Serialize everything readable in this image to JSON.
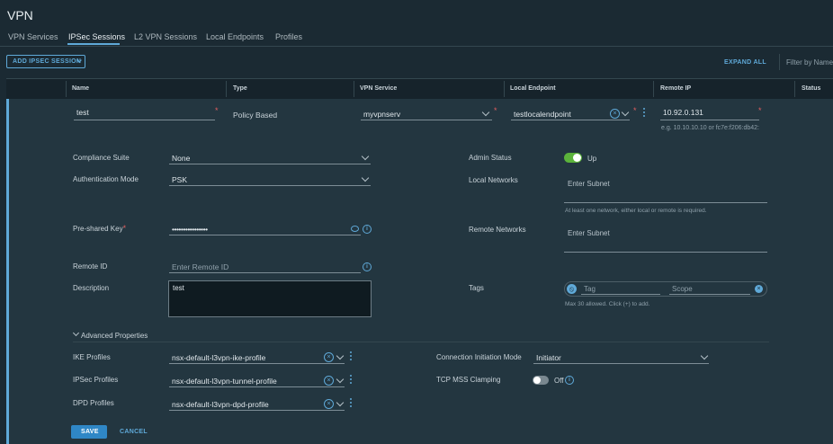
{
  "app": {
    "title": "VPN"
  },
  "tabs": [
    {
      "label": "VPN Services"
    },
    {
      "label": "IPSec Sessions"
    },
    {
      "label": "L2 VPN Sessions"
    },
    {
      "label": "Local Endpoints"
    },
    {
      "label": "Profiles"
    }
  ],
  "toolbar": {
    "add_label": "ADD IPSEC SESSION",
    "expand_label": "EXPAND ALL",
    "filter_placeholder": "Filter by Name,"
  },
  "table": {
    "columns": [
      "Name",
      "Type",
      "VPN Service",
      "Local Endpoint",
      "Remote IP",
      "Status"
    ]
  },
  "row": {
    "name": "test",
    "type": "Policy Based",
    "vpn_service": "myvpnserv",
    "local_endpoint": "testlocalendpoint",
    "remote_ip": "10.92.0.131",
    "remote_ip_hint": "e.g. 10.10.10.10 or fc7e:f206:db42:"
  },
  "form": {
    "compliance_suite": {
      "label": "Compliance Suite",
      "value": "None"
    },
    "auth_mode": {
      "label": "Authentication Mode",
      "value": "PSK"
    },
    "psk": {
      "label": "Pre-shared Key",
      "value": "••••••••••••••••"
    },
    "remote_id": {
      "label": "Remote ID",
      "placeholder": "Enter Remote ID"
    },
    "description": {
      "label": "Description",
      "value": "test"
    },
    "admin_status": {
      "label": "Admin Status",
      "value": "Up"
    },
    "local_networks": {
      "label": "Local Networks",
      "placeholder": "Enter Subnet",
      "hint": "At least one network, either local or remote is required."
    },
    "remote_networks": {
      "label": "Remote Networks",
      "placeholder": "Enter Subnet"
    },
    "tags": {
      "label": "Tags",
      "tag_placeholder": "Tag",
      "scope_placeholder": "Scope",
      "hint": "Max 30 allowed. Click (+) to add."
    }
  },
  "advanced": {
    "header": "Advanced Properties",
    "ike_profiles": {
      "label": "IKE Profiles",
      "value": "nsx-default-l3vpn-ike-profile"
    },
    "ipsec_profiles": {
      "label": "IPSec Profiles",
      "value": "nsx-default-l3vpn-tunnel-profile"
    },
    "dpd_profiles": {
      "label": "DPD Profiles",
      "value": "nsx-default-l3vpn-dpd-profile"
    },
    "connection_mode": {
      "label": "Connection Initiation Mode",
      "value": "Initiator"
    },
    "tcp_mss": {
      "label": "TCP MSS Clamping",
      "value": "Off"
    }
  },
  "actions": {
    "save_label": "SAVE",
    "cancel_label": "CANCEL"
  },
  "colors": {
    "accent": "#5fa9d8",
    "toggle_on": "#5bb33b",
    "save_button": "#2f87c6",
    "background": "#1b2a33",
    "row_bg": "#233640"
  }
}
